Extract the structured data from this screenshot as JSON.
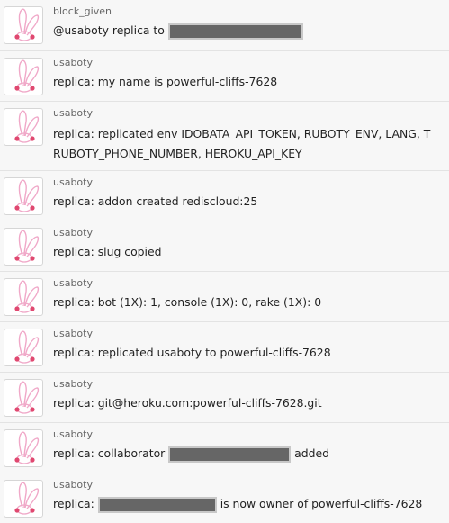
{
  "messages": [
    {
      "sender": "block_given",
      "text": "@usaboty replica to",
      "redaction": "before-end"
    },
    {
      "sender": "usaboty",
      "text": "replica: my name is powerful-cliffs-7628"
    },
    {
      "sender": "usaboty",
      "line1": "replica: replicated env IDOBATA_API_TOKEN, RUBOTY_ENV, LANG, T",
      "line2": "RUBOTY_PHONE_NUMBER, HEROKU_API_KEY"
    },
    {
      "sender": "usaboty",
      "text": "replica: addon created rediscloud:25"
    },
    {
      "sender": "usaboty",
      "text": "replica: slug copied"
    },
    {
      "sender": "usaboty",
      "text": "replica: bot (1X): 1, console (1X): 0, rake (1X): 0"
    },
    {
      "sender": "usaboty",
      "text": "replica: replicated usaboty to powerful-cliffs-7628"
    },
    {
      "sender": "usaboty",
      "text": "replica: git@heroku.com:powerful-cliffs-7628.git"
    },
    {
      "sender": "usaboty",
      "prefix": "replica: collaborator",
      "suffix": "added"
    },
    {
      "sender": "usaboty",
      "prefix": "replica:",
      "suffix": "is now owner of powerful-cliffs-7628"
    }
  ],
  "avatar_icon": "bunny-icon",
  "colors": {
    "background": "#f7f7f7",
    "divider": "#e3e3e3",
    "redaction": "#666666",
    "avatar_pink": "#f0a8c8"
  }
}
